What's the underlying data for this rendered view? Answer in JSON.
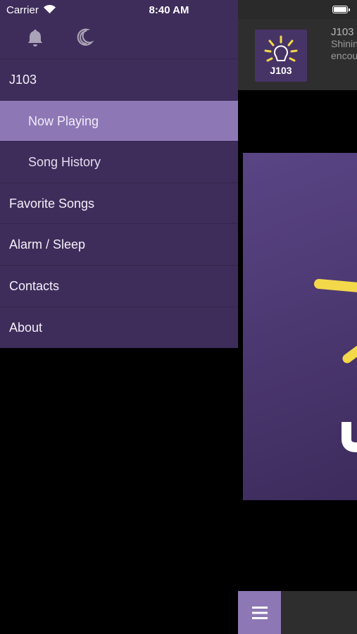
{
  "status_bar": {
    "carrier": "Carrier",
    "time": "8:40 AM"
  },
  "drawer": {
    "icons": [
      "bell-icon",
      "moon-icon"
    ],
    "items": [
      {
        "label": "J103",
        "level": 0,
        "active": false
      },
      {
        "label": "Now Playing",
        "level": 1,
        "active": true
      },
      {
        "label": "Song History",
        "level": 1,
        "active": false
      },
      {
        "label": "Favorite Songs",
        "level": 0,
        "active": false
      },
      {
        "label": "Alarm / Sleep",
        "level": 0,
        "active": false
      },
      {
        "label": "Contacts",
        "level": 0,
        "active": false
      },
      {
        "label": "About",
        "level": 0,
        "active": false
      }
    ]
  },
  "station": {
    "name": "J103",
    "tagline_line1": "Shinin",
    "tagline_line2": "encou",
    "logo_text": "J103"
  },
  "colors": {
    "drawer_bg": "#3e2d5a",
    "accent": "#8d78b5",
    "logo_yellow": "#f3d84a"
  }
}
